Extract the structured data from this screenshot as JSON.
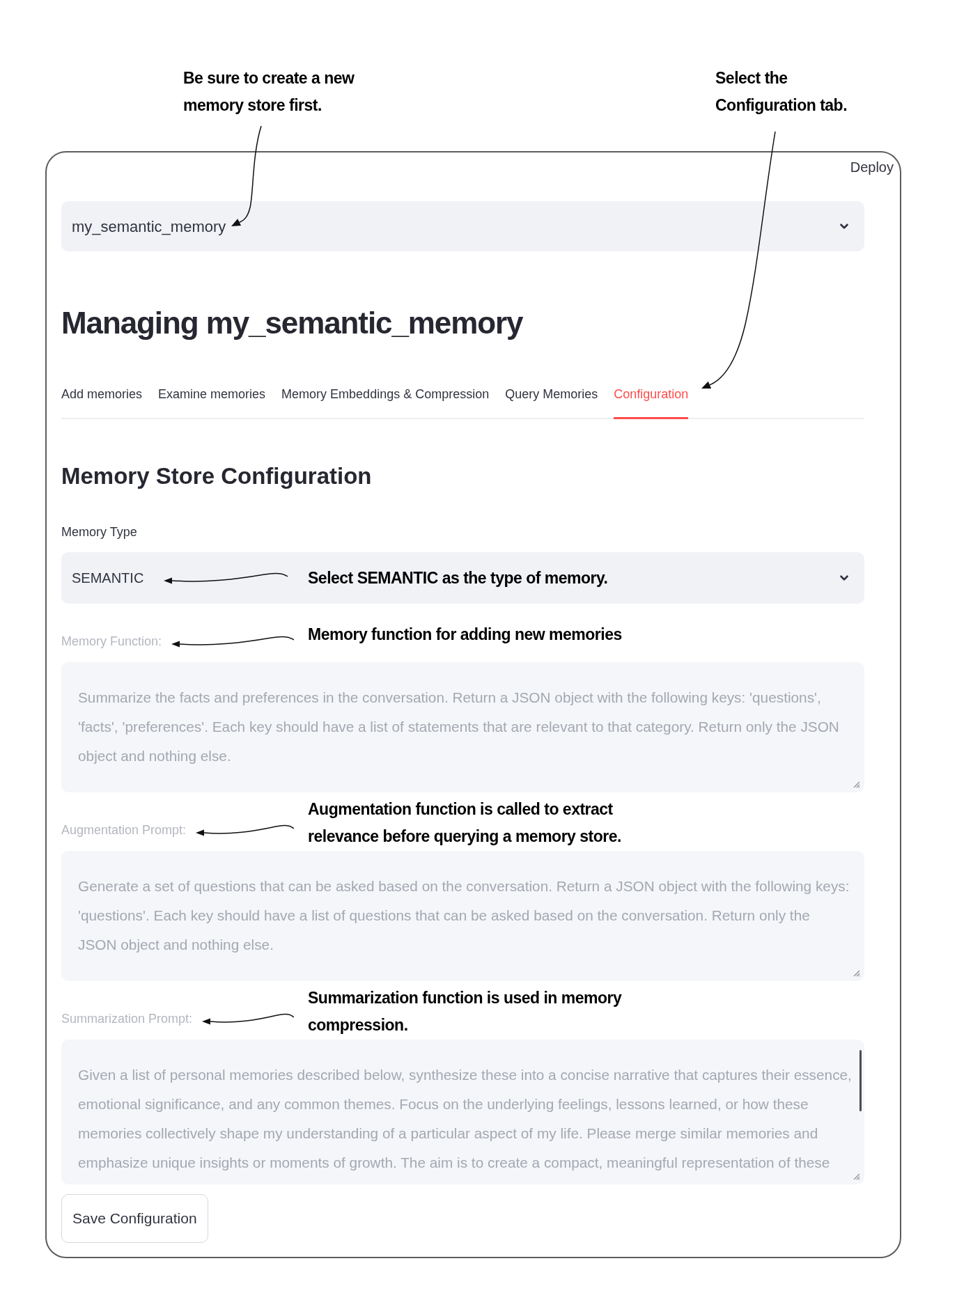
{
  "top_bar": {
    "deploy": "Deploy"
  },
  "store_select": {
    "value": "my_semantic_memory",
    "callout": "Be sure to create a new\nmemory store first."
  },
  "title": "Managing my_semantic_memory",
  "tabs": [
    {
      "label": "Add memories",
      "selected": false
    },
    {
      "label": "Examine memories",
      "selected": false
    },
    {
      "label": "Memory Embeddings & Compression",
      "selected": false
    },
    {
      "label": "Query Memories",
      "selected": false
    },
    {
      "label": "Configuration",
      "selected": true
    }
  ],
  "tabs_callout": "Select the\nConfiguration tab.",
  "section_title": "Memory Store Configuration",
  "memory_type": {
    "label": "Memory Type",
    "value": "SEMANTIC",
    "callout": "Select SEMANTIC as the type of memory."
  },
  "prompts": [
    {
      "label": "Memory Function:",
      "value": "Summarize the facts and preferences in the conversation. Return a JSON object with the following keys: 'questions', 'facts', 'preferences'. Each key should have a list of statements that are relevant to that category. Return only the JSON object and nothing else.",
      "disabled": true,
      "scrollbar": false,
      "callout": "Memory function for adding new memories"
    },
    {
      "label": "Augmentation Prompt:",
      "value": "Generate a set of questions that can be asked based on the conversation. Return a JSON object with the following keys: 'questions'. Each key should have a list of questions that can be asked based on the conversation. Return only the JSON object and nothing else.",
      "disabled": true,
      "scrollbar": false,
      "callout": "Augmentation function is called to extract\nrelevance before querying a memory store."
    },
    {
      "label": "Summarization Prompt:",
      "value": "Given a list of personal memories described below, synthesize these into a concise narrative that captures their essence, emotional significance, and any common themes. Focus on the underlying feelings, lessons learned, or how these memories collectively shape my understanding of a particular aspect of my life. Please merge similar memories and emphasize unique insights or moments of growth. The aim is to create a compact, meaningful representation of these",
      "disabled": true,
      "scrollbar": true,
      "callout": "Summarization function is used in memory\ncompression."
    }
  ],
  "save_button": "Save Configuration"
}
